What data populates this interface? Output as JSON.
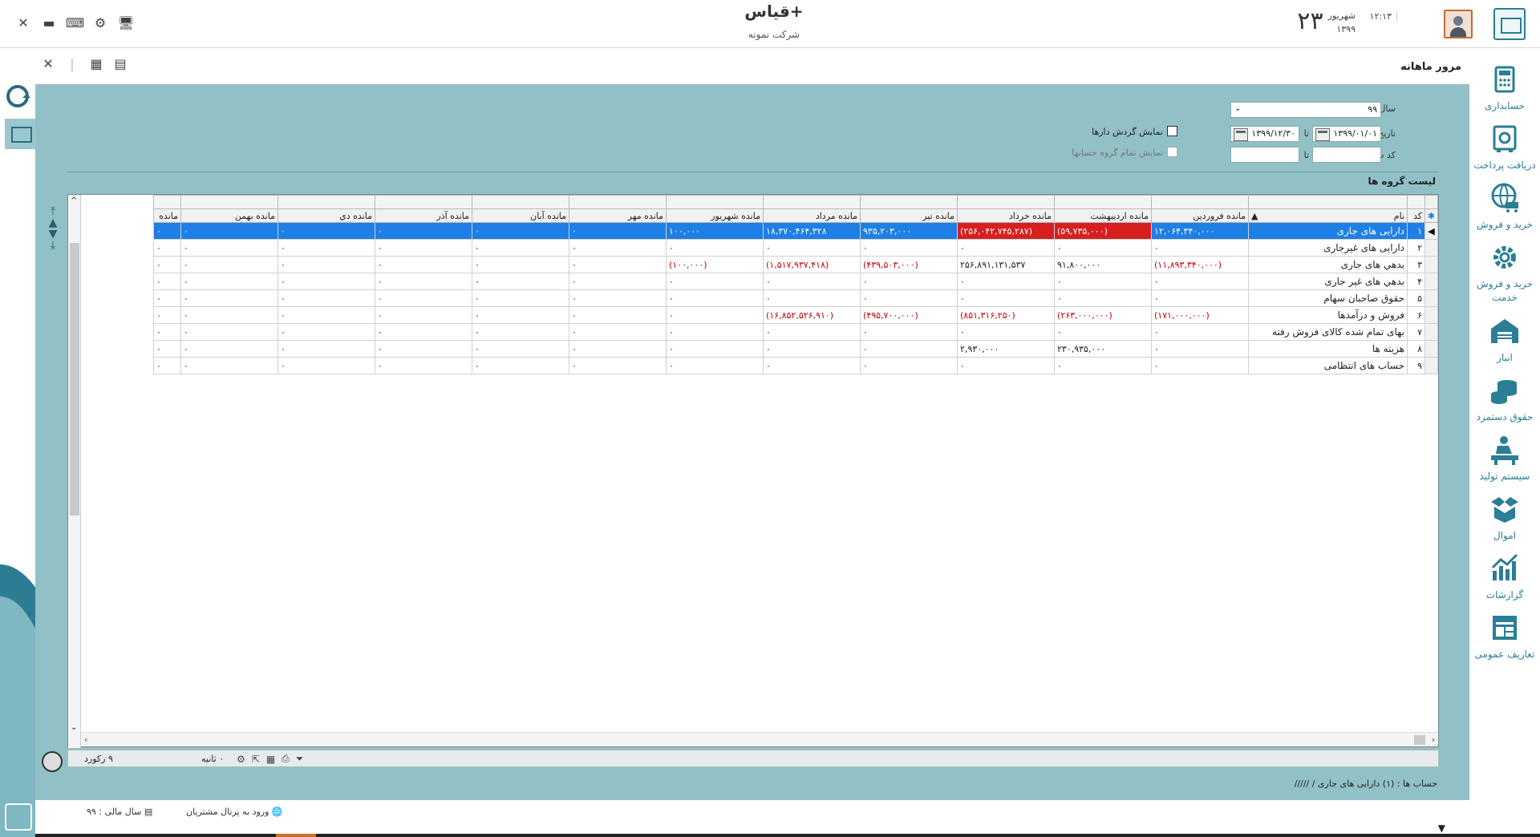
{
  "app": {
    "title": "قیاس+",
    "company": "شرکت نمونه",
    "day": "۲۳",
    "month": "شهریور",
    "year": "۱۳۹۹",
    "time": "۱۲:۱۳"
  },
  "window_controls": [
    "close-icon",
    "minimize-icon",
    "keyboard-icon",
    "settings-icon",
    "monitor-icon"
  ],
  "nav": [
    {
      "label": "حسابداری",
      "icon": "calculator-icon"
    },
    {
      "label": "دریافت پرداخت",
      "icon": "safe-icon"
    },
    {
      "label": "خرید و فروش",
      "icon": "globe-cart-icon"
    },
    {
      "label": "خرید و فروش خدمت",
      "icon": "gear-service-icon"
    },
    {
      "label": "انبار",
      "icon": "warehouse-icon"
    },
    {
      "label": "حقوق دستمزد",
      "icon": "coins-icon"
    },
    {
      "label": "سیستم تولید",
      "icon": "worker-icon"
    },
    {
      "label": "اموال",
      "icon": "box-icon"
    },
    {
      "label": "گزارشات",
      "icon": "chart-icon"
    },
    {
      "label": "تعاریف عمومی",
      "icon": "table-icon"
    }
  ],
  "page": {
    "title": "مرور ماهانه",
    "accent": "#91c1c6"
  },
  "filters": {
    "fiscal_year_label": "سال مالی",
    "fiscal_year_value": "۹۹",
    "date_from_label": "تاریخ از",
    "date_from_value": "۱۳۹۹/۰۱/۰۱",
    "to_label": "تا",
    "date_to_value": "۱۳۹۹/۱۲/۳۰",
    "doc_code_label": "کد سند از",
    "doc_code_from": "",
    "doc_code_to": "",
    "show_flow_label": "نمایش گردش دارها",
    "show_all_groups_label": "نمایش تمام گروه حسابها"
  },
  "grid": {
    "section_title": "لیست گروه ها",
    "columns": [
      "کد",
      "نام",
      "مانده فروردین",
      "مانده اردیبهشت",
      "مانده خرداد",
      "مانده تیر",
      "مانده مرداد",
      "مانده شهریور",
      "مانده مهر",
      "مانده آبان",
      "مانده آذر",
      "مانده دي",
      "مانده بهمن",
      "مانده"
    ],
    "rows": [
      {
        "code": "۱",
        "name": "دارایی های جاری",
        "values": [
          "۱۲,۰۶۴,۳۴۰,۰۰۰",
          "(۵۹,۷۳۵,۰۰۰)",
          "(۲۵۶,۰۴۲,۷۴۵,۲۸۷)",
          "۹۳۵,۲۰۳,۰۰۰",
          "۱۸,۳۷۰,۴۶۴,۳۲۸",
          "۱۰۰,۰۰۰",
          "۰",
          "۰",
          "۰",
          "۰",
          "۰",
          "۰"
        ],
        "neg": [
          false,
          true,
          true,
          false,
          false,
          false,
          false,
          false,
          false,
          false,
          false,
          false
        ],
        "selected": true
      },
      {
        "code": "۲",
        "name": "دارایی های غیرجاری",
        "values": [
          "۰",
          "۰",
          "۰",
          "۰",
          "۰",
          "۰",
          "۰",
          "۰",
          "۰",
          "۰",
          "۰",
          "۰"
        ],
        "neg": [
          false,
          false,
          false,
          false,
          false,
          false,
          false,
          false,
          false,
          false,
          false,
          false
        ]
      },
      {
        "code": "۳",
        "name": "بدهي های جاری",
        "values": [
          "(۱۱,۸۹۳,۳۴۰,۰۰۰)",
          "۹۱,۸۰۰,۰۰۰",
          "۲۵۶,۸۹۱,۱۳۱,۵۳۷",
          "(۴۳۹,۵۰۳,۰۰۰)",
          "(۱,۵۱۷,۹۳۷,۴۱۸)",
          "(۱۰۰,۰۰۰)",
          "۰",
          "۰",
          "۰",
          "۰",
          "۰",
          "۰"
        ],
        "neg": [
          true,
          false,
          false,
          true,
          true,
          true,
          false,
          false,
          false,
          false,
          false,
          false
        ]
      },
      {
        "code": "۴",
        "name": "بدهي های غیر جاری",
        "values": [
          "۰",
          "۰",
          "۰",
          "۰",
          "۰",
          "۰",
          "۰",
          "۰",
          "۰",
          "۰",
          "۰",
          "۰"
        ],
        "neg": [
          false,
          false,
          false,
          false,
          false,
          false,
          false,
          false,
          false,
          false,
          false,
          false
        ]
      },
      {
        "code": "۵",
        "name": "حقوق صاحبان سهام",
        "values": [
          "۰",
          "۰",
          "۰",
          "۰",
          "۰",
          "۰",
          "۰",
          "۰",
          "۰",
          "۰",
          "۰",
          "۰"
        ],
        "neg": [
          false,
          false,
          false,
          false,
          false,
          false,
          false,
          false,
          false,
          false,
          false,
          false
        ]
      },
      {
        "code": "۶",
        "name": "فروش و درآمدها",
        "values": [
          "(۱۷۱,۰۰۰,۰۰۰)",
          "(۲۶۳,۰۰۰,۰۰۰)",
          "(۸۵۱,۳۱۶,۲۵۰)",
          "(۴۹۵,۷۰۰,۰۰۰)",
          "(۱۶,۸۵۲,۵۲۶,۹۱۰)",
          "۰",
          "۰",
          "۰",
          "۰",
          "۰",
          "۰",
          "۰"
        ],
        "neg": [
          true,
          true,
          true,
          true,
          true,
          false,
          false,
          false,
          false,
          false,
          false,
          false
        ]
      },
      {
        "code": "۷",
        "name": "بهای تمام شده کالای فروش رفته",
        "values": [
          "۰",
          "۰",
          "۰",
          "۰",
          "۰",
          "۰",
          "۰",
          "۰",
          "۰",
          "۰",
          "۰",
          "۰"
        ],
        "neg": [
          false,
          false,
          false,
          false,
          false,
          false,
          false,
          false,
          false,
          false,
          false,
          false
        ]
      },
      {
        "code": "۸",
        "name": "هزینه ها",
        "values": [
          "۰",
          "۲۳۰,۹۳۵,۰۰۰",
          "۲,۹۳۰,۰۰۰",
          "۰",
          "۰",
          "۰",
          "۰",
          "۰",
          "۰",
          "۰",
          "۰",
          "۰"
        ],
        "neg": [
          false,
          false,
          false,
          false,
          false,
          false,
          false,
          false,
          false,
          false,
          false,
          false
        ]
      },
      {
        "code": "۹",
        "name": "حساب های انتظامی",
        "values": [
          "۰",
          "۰",
          "۰",
          "۰",
          "۰",
          "۰",
          "۰",
          "۰",
          "۰",
          "۰",
          "۰",
          "۰"
        ],
        "neg": [
          false,
          false,
          false,
          false,
          false,
          false,
          false,
          false,
          false,
          false,
          false,
          false
        ]
      }
    ]
  },
  "footer": {
    "time": "۰ ثانیه",
    "records": "۹ رکورد",
    "account_status": "حساب ها :  (۱) دارایی های جاری / /////"
  },
  "statusbar": {
    "portal": "ورود به پرتال مشتریان",
    "fiscal_year": "سال مالی : ۹۹"
  }
}
